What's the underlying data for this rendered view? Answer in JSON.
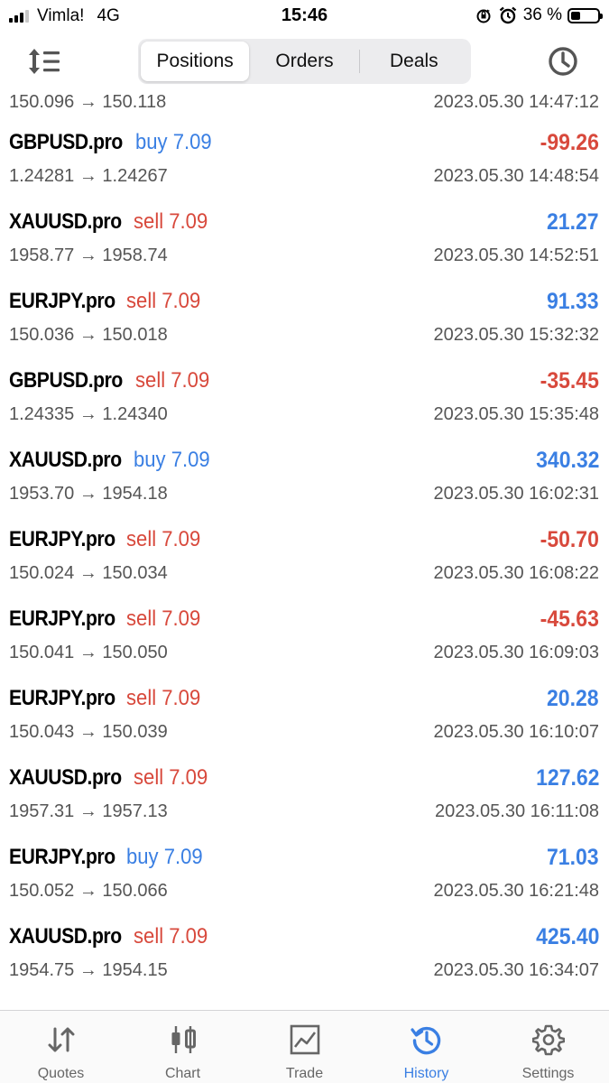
{
  "status_bar": {
    "carrier": "Vimla!",
    "network": "4G",
    "time": "15:46",
    "battery": "36 %",
    "battery_level": 0.36
  },
  "toolbar": {
    "segments": [
      "Positions",
      "Orders",
      "Deals"
    ],
    "active_segment": "Positions"
  },
  "colors": {
    "buy": "#3a7fe3",
    "sell": "#d8493c",
    "accent": "#3a7fe3"
  },
  "partial_row": {
    "prices": "150.096 → 150.118",
    "time": "2023.05.30 14:47:12"
  },
  "deals": [
    {
      "symbol": "GBPUSD.pro",
      "side": "buy 7.09",
      "profit": "-99.26",
      "prices": "1.24281 → 1.24267",
      "time": "2023.05.30 14:48:54"
    },
    {
      "symbol": "XAUUSD.pro",
      "side": "sell 7.09",
      "profit": "21.27",
      "prices": "1958.77 → 1958.74",
      "time": "2023.05.30 14:52:51"
    },
    {
      "symbol": "EURJPY.pro",
      "side": "sell 7.09",
      "profit": "91.33",
      "prices": "150.036 → 150.018",
      "time": "2023.05.30 15:32:32"
    },
    {
      "symbol": "GBPUSD.pro",
      "side": "sell 7.09",
      "profit": "-35.45",
      "prices": "1.24335 → 1.24340",
      "time": "2023.05.30 15:35:48"
    },
    {
      "symbol": "XAUUSD.pro",
      "side": "buy 7.09",
      "profit": "340.32",
      "prices": "1953.70 → 1954.18",
      "time": "2023.05.30 16:02:31"
    },
    {
      "symbol": "EURJPY.pro",
      "side": "sell 7.09",
      "profit": "-50.70",
      "prices": "150.024 → 150.034",
      "time": "2023.05.30 16:08:22"
    },
    {
      "symbol": "EURJPY.pro",
      "side": "sell 7.09",
      "profit": "-45.63",
      "prices": "150.041 → 150.050",
      "time": "2023.05.30 16:09:03"
    },
    {
      "symbol": "EURJPY.pro",
      "side": "sell 7.09",
      "profit": "20.28",
      "prices": "150.043 → 150.039",
      "time": "2023.05.30 16:10:07"
    },
    {
      "symbol": "XAUUSD.pro",
      "side": "sell 7.09",
      "profit": "127.62",
      "prices": "1957.31 → 1957.13",
      "time": "2023.05.30 16:11:08"
    },
    {
      "symbol": "EURJPY.pro",
      "side": "buy 7.09",
      "profit": "71.03",
      "prices": "150.052 → 150.066",
      "time": "2023.05.30 16:21:48"
    },
    {
      "symbol": "XAUUSD.pro",
      "side": "sell 7.09",
      "profit": "425.40",
      "prices": "1954.75 → 1954.15",
      "time": "2023.05.30 16:34:07"
    }
  ],
  "tabbar": {
    "tabs": [
      {
        "label": "Quotes",
        "icon": "quotes-arrows-icon"
      },
      {
        "label": "Chart",
        "icon": "candlestick-chart-icon"
      },
      {
        "label": "Trade",
        "icon": "trade-chart-icon"
      },
      {
        "label": "History",
        "icon": "history-clock-icon"
      },
      {
        "label": "Settings",
        "icon": "gear-icon"
      }
    ],
    "active_tab": "History"
  }
}
